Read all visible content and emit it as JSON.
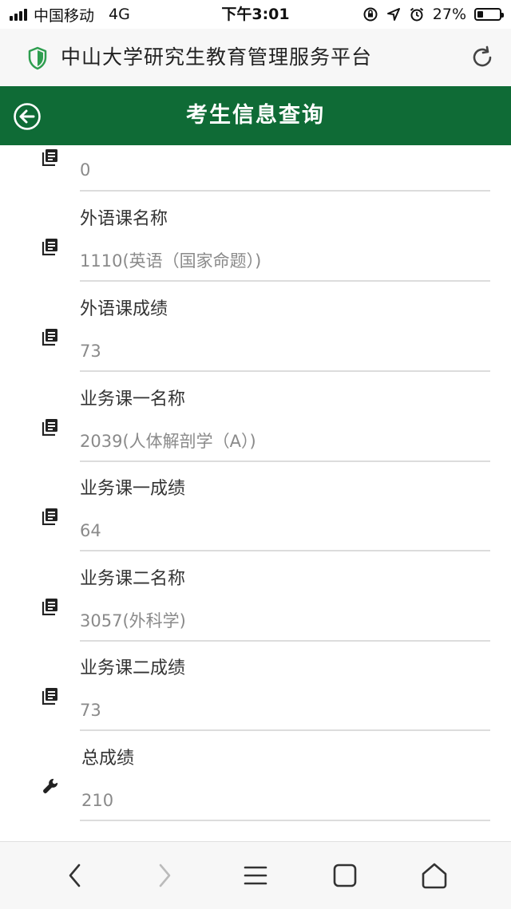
{
  "status_bar": {
    "carrier": "中国移动",
    "network": "4G",
    "time": "下午3:01",
    "battery_percent": "27%",
    "battery_level": 0.27
  },
  "browser": {
    "site_title": "中山大学研究生教育管理服务平台",
    "secure_icon": "shield-icon",
    "reload_icon": "reload-icon"
  },
  "app_bar": {
    "title": "考生信息查询",
    "back_icon": "back-circle-icon"
  },
  "fields": [
    {
      "label": "",
      "value": "0",
      "icon": "list-icon"
    },
    {
      "label": "外语课名称",
      "value": "1110(英语（国家命题）)",
      "icon": "list-icon"
    },
    {
      "label": "外语课成绩",
      "value": "73",
      "icon": "list-icon"
    },
    {
      "label": "业务课一名称",
      "value": "2039(人体解剖学（A）)",
      "icon": "list-icon"
    },
    {
      "label": "业务课一成绩",
      "value": "64",
      "icon": "list-icon"
    },
    {
      "label": "业务课二名称",
      "value": "3057(外科学)",
      "icon": "list-icon"
    },
    {
      "label": "业务课二成绩",
      "value": "73",
      "icon": "list-icon"
    },
    {
      "label": "总成绩",
      "value": "210",
      "icon": "wrench-icon"
    }
  ],
  "bottom_nav": {
    "items": [
      "back-icon",
      "forward-icon",
      "menu-icon",
      "tabs-icon",
      "home-icon"
    ]
  },
  "colors": {
    "accent": "#0f6b36",
    "shield": "#2e9e4f"
  }
}
